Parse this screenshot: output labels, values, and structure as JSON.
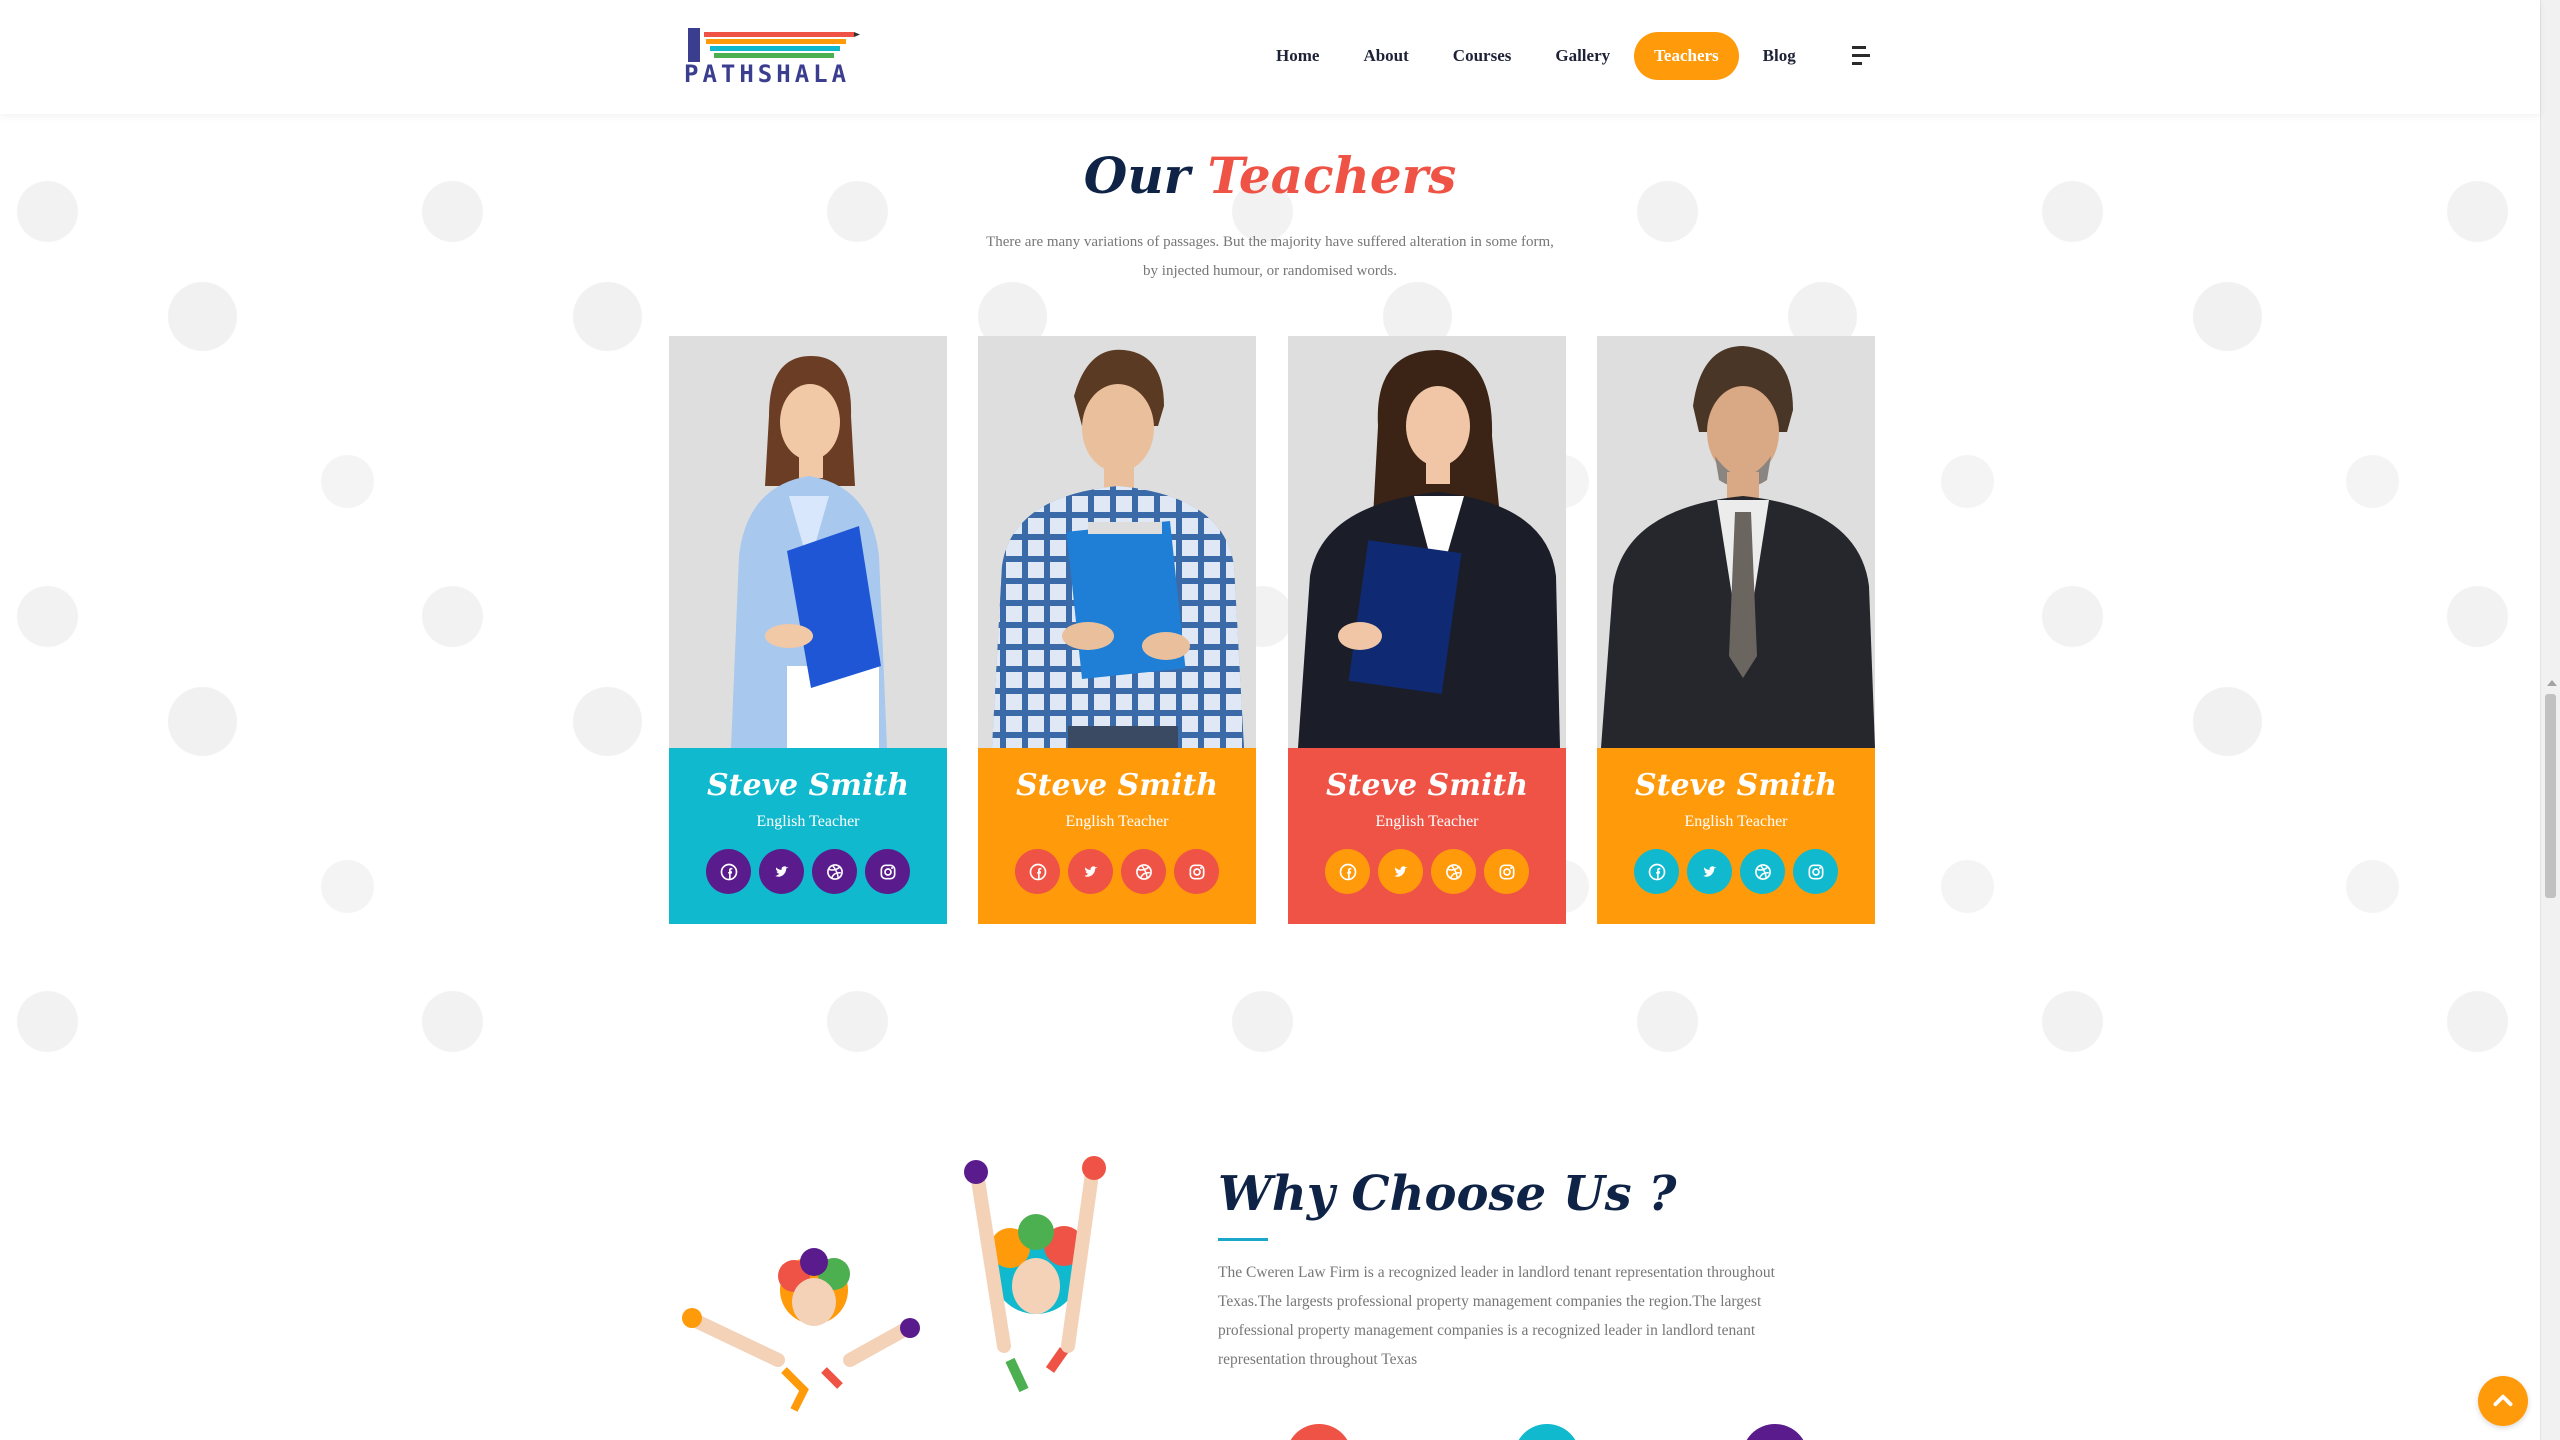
{
  "header": {
    "logo_text": "PATHSHALA",
    "nav": [
      {
        "label": "Home",
        "active": false
      },
      {
        "label": "About",
        "active": false
      },
      {
        "label": "Courses",
        "active": false
      },
      {
        "label": "Gallery",
        "active": false
      },
      {
        "label": "Teachers",
        "active": true
      },
      {
        "label": "Blog",
        "active": false
      }
    ]
  },
  "teachers_section": {
    "title_part1": "Our",
    "title_part2": "Teachers",
    "subtitle": "There are many variations of passages. But the majority have suffered alteration in some form, by injected humour, or randomised words.",
    "cards": [
      {
        "name": "Steve Smith",
        "role": "English Teacher",
        "bg": "#10b9cd",
        "icon_bg": "#5a1c8c"
      },
      {
        "name": "Steve Smith",
        "role": "English Teacher",
        "bg": "#ff9a0a",
        "icon_bg": "#ef5346"
      },
      {
        "name": "Steve Smith",
        "role": "English Teacher",
        "bg": "#ef5346",
        "icon_bg": "#ff9a0a"
      },
      {
        "name": "Steve Smith",
        "role": "English Teacher",
        "bg": "#ff9a0a",
        "icon_bg": "#10b9cd"
      }
    ],
    "social_icons": [
      "facebook-icon",
      "twitter-icon",
      "dribbble-icon",
      "instagram-icon"
    ]
  },
  "why_section": {
    "title": "Why Choose Us ?",
    "text": "The Cweren Law Firm is a recognized leader in landlord tenant representation throughout Texas.The largests professional property management companies the region.The largest professional property management companies is a recognized leader in landlord tenant representation throughout Texas",
    "feature_colors": [
      "#ef5346",
      "#10b9cd",
      "#5a1c8c"
    ]
  },
  "colors": {
    "orange": "#ff9a0a",
    "red": "#ef5346",
    "cyan": "#10b9cd",
    "purple": "#5a1c8c",
    "navy": "#0f2347"
  }
}
